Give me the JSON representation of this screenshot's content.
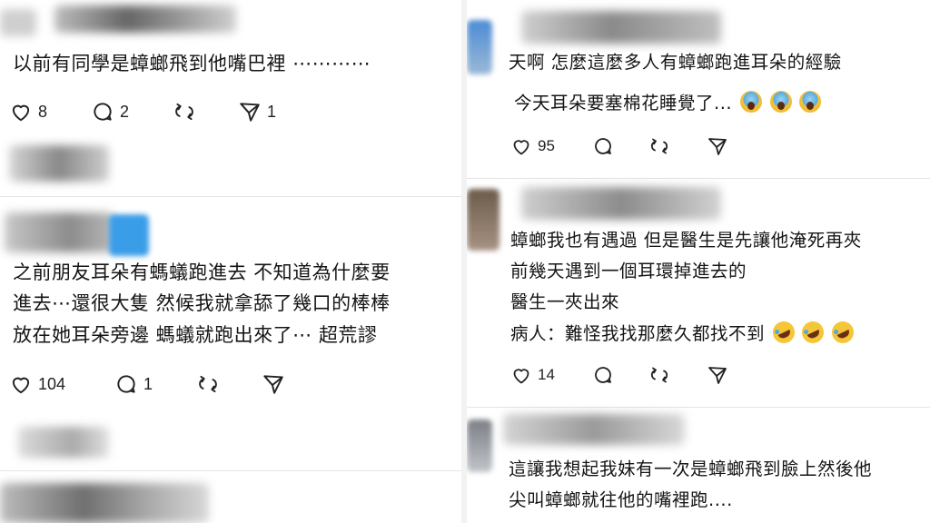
{
  "left": {
    "post1": {
      "lines": [
        "以前有同學是蟑螂飛到他嘴巴裡 ⋯⋯⋯⋯"
      ],
      "likes": "8",
      "replies": "2",
      "reposts": "",
      "shares": "1"
    },
    "post2": {
      "lines": [
        "之前朋友耳朵有螞蟻跑進去 不知道為什麼要",
        "進去⋯還很大隻 然候我就拿舔了幾口的棒棒",
        "放在她耳朵旁邊 螞蟻就跑出來了⋯ 超荒謬"
      ],
      "likes": "104",
      "replies": "1",
      "reposts": "",
      "shares": ""
    }
  },
  "right": {
    "post1": {
      "lines": [
        "天啊 怎麼這麼多人有蟑螂跑進耳朵的經驗",
        "今天耳朵要塞棉花睡覺了..."
      ],
      "emoji": [
        "scream",
        "scream",
        "scream"
      ],
      "likes": "95"
    },
    "post2": {
      "lines": [
        "蟑螂我也有遇過 但是醫生是先讓他淹死再夾",
        "前幾天遇到一個耳環掉進去的",
        "醫生一夾出來",
        "病人：難怪我找那麼久都找不到"
      ],
      "emoji": [
        "rofl",
        "rofl",
        "rofl"
      ],
      "likes": "14"
    },
    "post3": {
      "lines": [
        "這讓我想起我妹有一次是蟑螂飛到臉上然後他",
        "尖叫蟑螂就往他的嘴裡跑...."
      ]
    }
  },
  "icons": {
    "like": "heart-icon",
    "reply": "comment-icon",
    "repost": "repost-icon",
    "share": "send-icon"
  }
}
